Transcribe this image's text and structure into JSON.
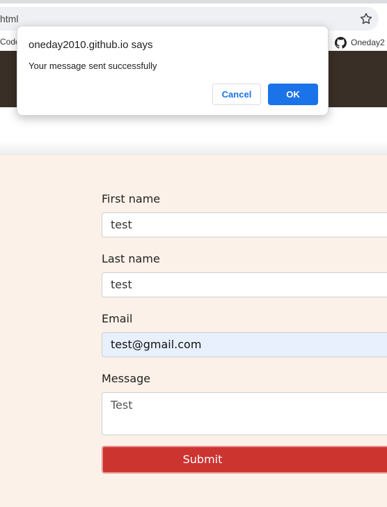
{
  "browser": {
    "url_fragment": "html",
    "bookmark_left": "Code",
    "bookmark_right": "Oneday2"
  },
  "dialog": {
    "title": "oneday2010.github.io says",
    "message": "Your message sent successfully",
    "cancel_label": "Cancel",
    "ok_label": "OK"
  },
  "form": {
    "first_name_label": "First name",
    "first_name_value": "test",
    "last_name_label": "Last name",
    "last_name_value": "test",
    "email_label": "Email",
    "email_value": "test@gmail.com",
    "message_label": "Message",
    "message_value": "Test",
    "submit_label": "Submit"
  },
  "colors": {
    "hero": "#3a2f26",
    "section_bg": "#fbf1e8",
    "submit": "#cc3430",
    "accent": "#1a73e8"
  }
}
